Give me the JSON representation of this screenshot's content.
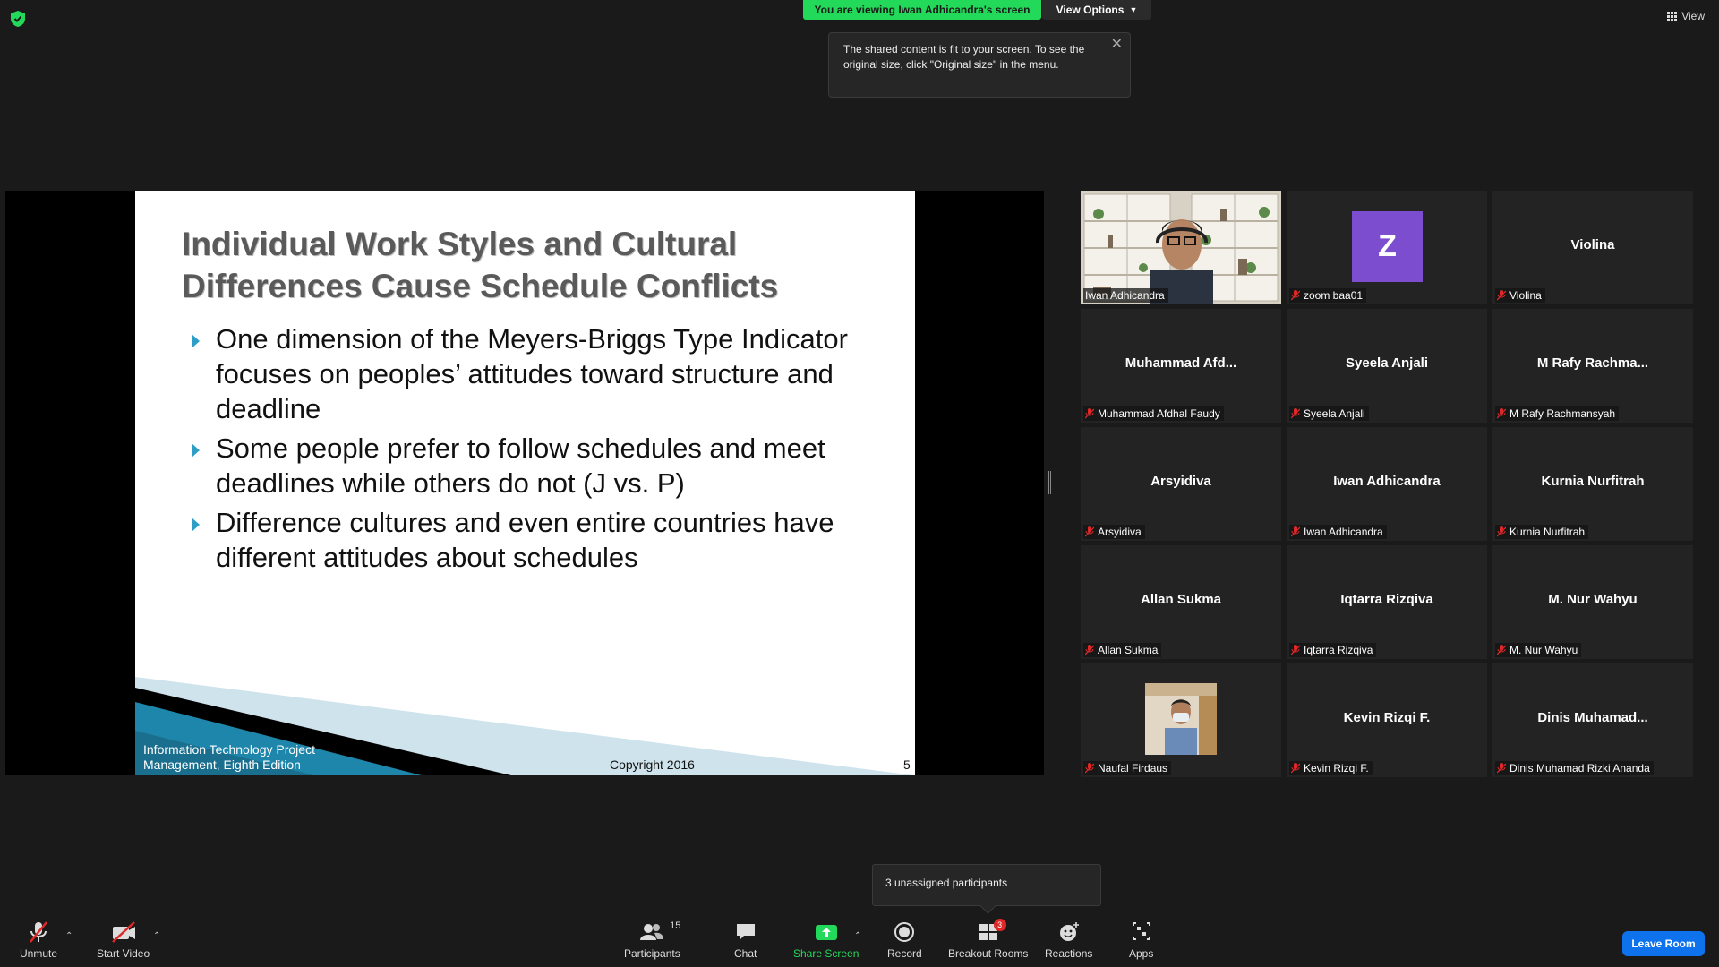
{
  "top": {
    "viewing_banner": "You are viewing Iwan Adhicandra's screen",
    "view_options": "View Options",
    "view": "View"
  },
  "tooltip": {
    "text": "The shared content is fit to your screen. To see the original size, click \"Original size\" in the menu."
  },
  "slide": {
    "title": "Individual Work Styles and Cultural Differences Cause Schedule Conflicts",
    "bullets": [
      "One dimension of the Meyers-Briggs Type Indicator focuses on peoples’ attitudes toward structure and deadline",
      "Some people prefer to follow schedules and meet deadlines while others do not  (J vs. P)",
      "Difference cultures and even entire countries have different attitudes about schedules"
    ],
    "footer_left": "Information Technology Project Management, Eighth Edition",
    "footer_mid": "Copyright 2016",
    "page_number": "5",
    "accent_color": "#2f9ec6"
  },
  "gallery": {
    "tiles": [
      {
        "display": "",
        "label": "Iwan Adhicandra",
        "type": "video"
      },
      {
        "display": "Z",
        "label": "zoom baa01",
        "type": "avatar"
      },
      {
        "display": "Violina",
        "label": "Violina",
        "type": "name"
      },
      {
        "display": "Muhammad  Afd...",
        "label": "Muhammad Afdhal Faudy",
        "type": "name"
      },
      {
        "display": "Syeela Anjali",
        "label": "Syeela Anjali",
        "type": "name"
      },
      {
        "display": "M  Rafy  Rachma...",
        "label": "M Rafy Rachmansyah",
        "type": "name"
      },
      {
        "display": "Arsyidiva",
        "label": "Arsyidiva",
        "type": "name"
      },
      {
        "display": "Iwan Adhicandra",
        "label": "Iwan Adhicandra",
        "type": "name"
      },
      {
        "display": "Kurnia Nurfitrah",
        "label": "Kurnia Nurfitrah",
        "type": "name"
      },
      {
        "display": "Allan Sukma",
        "label": "Allan Sukma",
        "type": "name"
      },
      {
        "display": "Iqtarra Rizqiva",
        "label": "Iqtarra Rizqiva",
        "type": "name"
      },
      {
        "display": "M. Nur Wahyu",
        "label": "M. Nur Wahyu",
        "type": "name"
      },
      {
        "display": "",
        "label": "Naufal Firdaus",
        "type": "photo"
      },
      {
        "display": "Kevin Rizqi F.",
        "label": "Kevin Rizqi F.",
        "type": "name"
      },
      {
        "display": "Dinis  Muhamad...",
        "label": "Dinis Muhamad Rizki Ananda",
        "type": "name"
      }
    ],
    "active_color": "#c8e62a",
    "avatar_color": "#7c4dcf"
  },
  "unassigned": "3 unassigned participants",
  "toolbar": {
    "unmute": "Unmute",
    "start_video": "Start Video",
    "participants": "Participants",
    "participants_count": "15",
    "chat": "Chat",
    "share_screen": "Share Screen",
    "record": "Record",
    "breakout_rooms": "Breakout Rooms",
    "breakout_badge": "3",
    "reactions": "Reactions",
    "apps": "Apps",
    "leave_room": "Leave Room"
  }
}
